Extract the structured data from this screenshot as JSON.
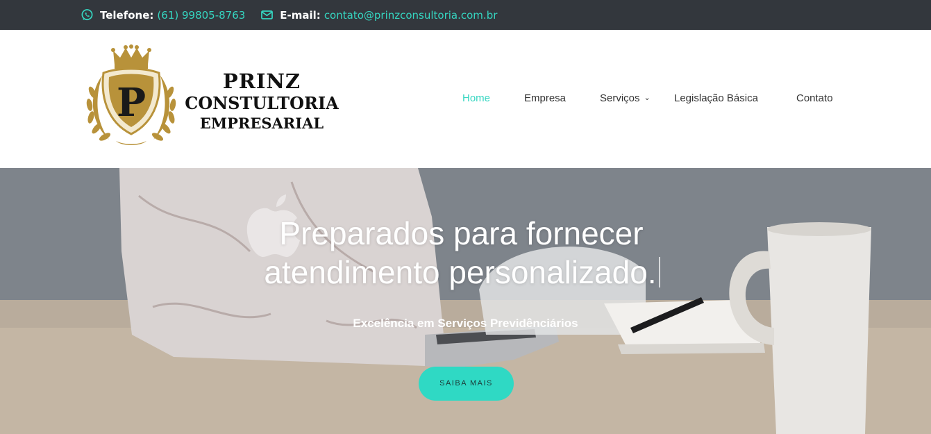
{
  "topbar": {
    "phone_label": "Telefone:",
    "phone_value": "(61) 99805-8763",
    "email_label": "E-mail:",
    "email_value": "contato@prinzconsultoria.com.br",
    "phone_icon": "whatsapp-icon",
    "email_icon": "envelope-icon"
  },
  "logo": {
    "emblem_letter": "P",
    "line1": "PRINZ",
    "line2": "CONSTULTORIA",
    "line3": "EMPRESARIAL"
  },
  "nav": {
    "items": [
      {
        "label": "Home",
        "active": true
      },
      {
        "label": "Empresa"
      },
      {
        "label": "Serviços",
        "has_dropdown": true
      },
      {
        "label": "Legislação Básica"
      },
      {
        "label": "Contato"
      }
    ]
  },
  "hero": {
    "title_line1": "Preparados para fornecer",
    "title_line2": "atendimento personalizado.",
    "subtitle": "Excelência em Serviços Previdênciários",
    "button_label": "SAIBA MAIS"
  },
  "colors": {
    "accent": "#35d6c1",
    "topbar_bg": "#33373d",
    "button_bg": "#2fd9c4",
    "gold": "#b8923a"
  }
}
